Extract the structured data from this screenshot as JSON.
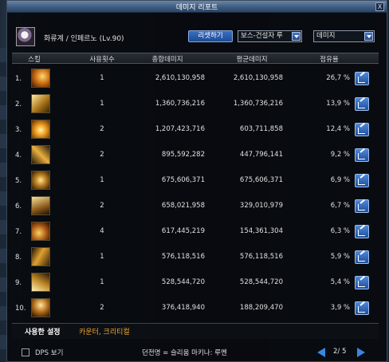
{
  "window": {
    "title": "데미지 리포트",
    "close_label": "X"
  },
  "character": {
    "name": "화류계 / 인페르노 (Lv.90)"
  },
  "controls": {
    "reset_label": "리셋하기",
    "target_value": "보스-건설자 루",
    "metric_value": "데미지"
  },
  "columns": {
    "skill": "스킬",
    "count": "사용횟수",
    "total": "총합데미지",
    "avg": "평균데미지",
    "share": "점유율"
  },
  "rows": [
    {
      "rank": "1.",
      "count": "1",
      "total": "2,610,130,958",
      "avg": "2,610,130,958",
      "share": "26,7 %",
      "icon": "skill-icon-flame"
    },
    {
      "rank": "2.",
      "count": "1",
      "total": "1,360,736,216",
      "avg": "1,360,736,216",
      "share": "13,9 %",
      "icon": "skill-icon-tower"
    },
    {
      "rank": "3.",
      "count": "2",
      "total": "1,207,423,716",
      "avg": "603,711,858",
      "share": "12,4 %",
      "icon": "skill-icon-fire"
    },
    {
      "rank": "4.",
      "count": "2",
      "total": "895,592,282",
      "avg": "447,796,141",
      "share": "9,2 %",
      "icon": "skill-icon-swirl"
    },
    {
      "rank": "5.",
      "count": "1",
      "total": "675,606,371",
      "avg": "675,606,371",
      "share": "6,9 %",
      "icon": "skill-icon-cross"
    },
    {
      "rank": "6.",
      "count": "2",
      "total": "658,021,958",
      "avg": "329,010,979",
      "share": "6,7 %",
      "icon": "skill-icon-burst"
    },
    {
      "rank": "7.",
      "count": "4",
      "total": "617,445,219",
      "avg": "154,361,304",
      "share": "6,3 %",
      "icon": "skill-icon-orb"
    },
    {
      "rank": "8.",
      "count": "1",
      "total": "576,118,516",
      "avg": "576,118,516",
      "share": "5,9 %",
      "icon": "skill-icon-slash"
    },
    {
      "rank": "9.",
      "count": "1",
      "total": "528,544,720",
      "avg": "528,544,720",
      "share": "5,4 %",
      "icon": "skill-icon-strike"
    },
    {
      "rank": "10.",
      "count": "2",
      "total": "376,418,940",
      "avg": "188,209,470",
      "share": "3,9 %",
      "icon": "skill-icon-blaze"
    }
  ],
  "tabs": {
    "settings": "사용한 설정",
    "counter": "카운터, 크리티컬"
  },
  "footer": {
    "dps_label": "DPS 보기",
    "dungeon": "던전명 = 슬리움 마키나: 루멘",
    "page": "2/ 5"
  },
  "colors": {
    "accent": "#3a86e0",
    "tab_inactive": "#f0a830"
  }
}
